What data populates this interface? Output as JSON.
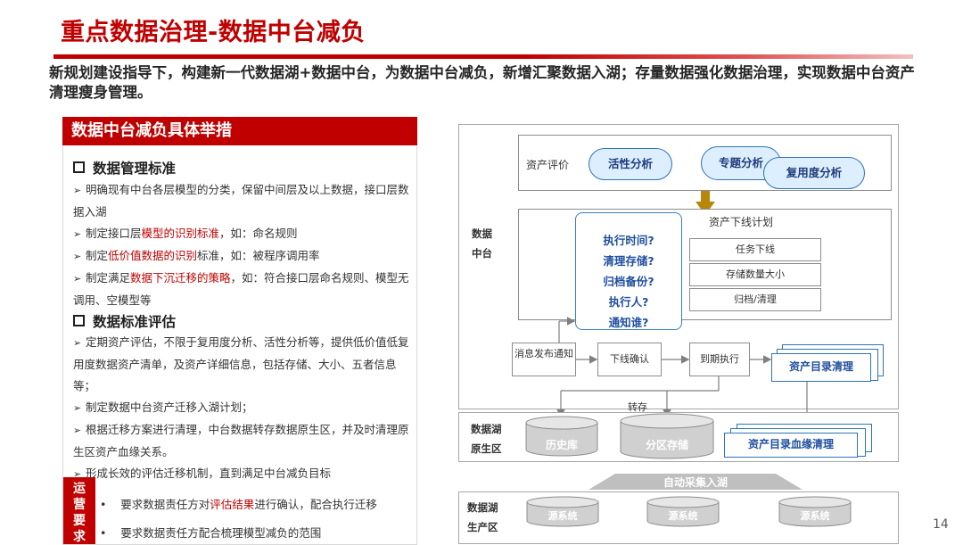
{
  "title": "重点数据治理-数据中台减负",
  "subtitle": "新规划建设指导下，构建新一代数据湖+数据中台，为数据中台减负，新增汇聚数据入湖；存量数据强化数据治理，实现数据中台资产清理瘦身管理。",
  "left_panel": {
    "header": "数据中台减负具体举措",
    "section1": {
      "title": "数据管理标准",
      "items": [
        {
          "pre": "明确现有中台各层模型的分类，保留中间层及以上数据，接口层数据入湖",
          "hl": "",
          "post": ""
        },
        {
          "pre": "制定接口层",
          "hl": "模型的识别标准",
          "post": "，如：命名规则"
        },
        {
          "pre": "制定",
          "hl": "低价值数据的识别",
          "post": "标准，如：被程序调用率"
        },
        {
          "pre": "制定满足",
          "hl": "数据下沉迁移的策略",
          "post": "，如：符合接口层命名规则、模型无调用、空模型等"
        }
      ]
    },
    "section2": {
      "title": "数据标准评估",
      "items": [
        "定期资产评估，不限于复用度分析、活性分析等，提供低价值低复用度数据资产清单，及资产详细信息，包括存储、大小、五者信息等；",
        "制定数据中台资产迁移入湖计划；",
        "根据迁移方案进行清理，中台数据转存数据原生区，并及时清理原生区资产血缘关系。",
        "形成长效的评估迁移机制，直到满足中台减负目标"
      ]
    },
    "ops": {
      "tab": [
        "运",
        "营",
        "要",
        "求"
      ],
      "line1_pre": "要求数据责任方对",
      "line1_hl": "评估结果",
      "line1_post": "进行确认，配合执行迁移",
      "line2": "要求数据责任方配合梳理模型减负的范围"
    }
  },
  "diagram": {
    "zhongtai_label": [
      "数据",
      "中台"
    ],
    "asset_eval_label": "资产评价",
    "clouds": [
      "活性分析",
      "专题分析",
      "复用度分析"
    ],
    "plan_label": "资产下线计划",
    "questions": [
      "执行时间?",
      "清理存储?",
      "归档备份?",
      "执行人?",
      "通知谁?"
    ],
    "tasks": [
      "任务下线",
      "存储数量大小",
      "归档/清理"
    ],
    "flow": [
      "消息发布通知",
      "下线确认",
      "到期执行",
      "资产目录清理"
    ],
    "transfer_label": "转存",
    "raw_zone_label": [
      "数据湖",
      "原生区"
    ],
    "raw_cylinders": [
      "历史库",
      "分区存储"
    ],
    "lineage_label": "资产目录血缘清理",
    "auto_ingest_label": "自动采集入湖",
    "prod_zone_label": [
      "数据湖",
      "生产区"
    ],
    "prod_cylinders": [
      "源系统",
      "源系统",
      "源系统"
    ]
  },
  "page_number": "14",
  "colors": {
    "brand_red": "#c00000",
    "blue": "#2e74b5",
    "gold": "#b8860b"
  }
}
